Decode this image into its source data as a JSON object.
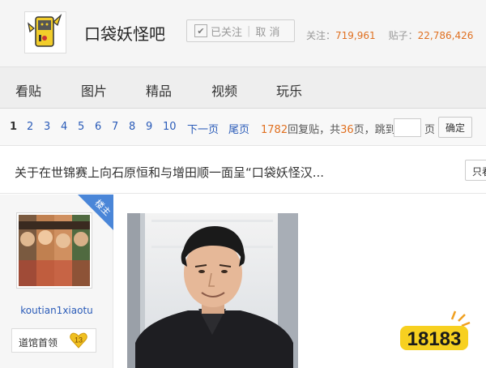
{
  "header": {
    "forum_name": "口袋妖怪吧",
    "follow_check": "✔",
    "follow_label": "已关注",
    "unfollow_label": "取 消",
    "follow_count_label": "关注：",
    "follow_count": "719,961",
    "post_count_label": "贴子：",
    "post_count": "22,786,426"
  },
  "nav": {
    "tabs": [
      "看贴",
      "图片",
      "精品",
      "视频",
      "玩乐"
    ]
  },
  "pager": {
    "pages": [
      "1",
      "2",
      "3",
      "4",
      "5",
      "6",
      "7",
      "8",
      "9",
      "10"
    ],
    "next_label": "下一页",
    "last_label": "尾页",
    "reply_count": "1782",
    "reply_text": "回复贴，共",
    "page_total": "36",
    "page_text": "页，跳到",
    "page_unit": "页",
    "go_label": "确定"
  },
  "thread": {
    "title": "关于在世锦赛上向石原恒和与增田顺一面呈“口袋妖怪汉...",
    "only_op_label": "只看"
  },
  "post": {
    "op_badge": "楼主",
    "username": "koutian1xiaotu",
    "level_name": "道馆首领",
    "level_num": "13"
  },
  "watermark": {
    "text": "18183"
  },
  "colors": {
    "link": "#2a5bb8",
    "orange": "#e07020",
    "badge": "#4a86d8",
    "level": "#f0c020"
  },
  "icons": {
    "forum_logo": "pikachu-gameboy-icon",
    "check": "check-icon",
    "level": "heart-level-icon"
  }
}
